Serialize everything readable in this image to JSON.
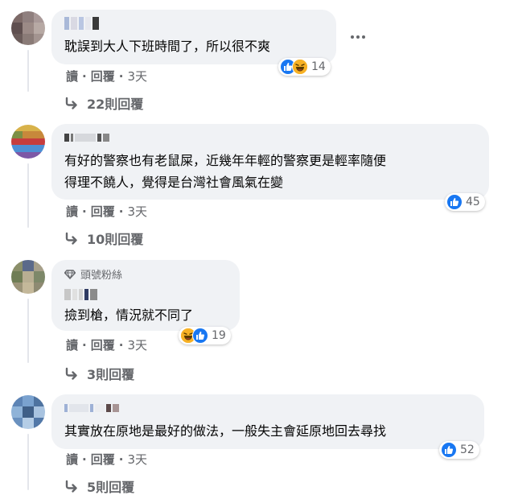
{
  "colors": {
    "bubble_bg": "#f0f2f5",
    "secondary_text": "#65676b",
    "like_blue": "#1877f2",
    "haha_yellow": "#f7b125"
  },
  "comments": [
    {
      "author_name_redacted": true,
      "text_lines": [
        "耽誤到大人下班時間了，所以很不爽"
      ],
      "actions": {
        "read": "讀",
        "reply": "回覆",
        "time": "3天"
      },
      "reactions": {
        "icons": [
          "like-icon",
          "haha-icon"
        ],
        "count": "14"
      },
      "replies_label": "22則回覆",
      "has_more_menu": true
    },
    {
      "author_name_redacted": true,
      "text_lines": [
        "有好的警察也有老鼠屎，近幾年年輕的警察更是輕率隨便",
        "得理不饒人，覺得是台灣社會風氣在變"
      ],
      "actions": {
        "read": "讀",
        "reply": "回覆",
        "time": "3天"
      },
      "reactions": {
        "icons": [
          "like-icon"
        ],
        "count": "45"
      },
      "replies_label": "10則回覆"
    },
    {
      "author_name_redacted": true,
      "badge": "頭號粉絲",
      "text_lines": [
        "撿到槍，情況就不同了"
      ],
      "actions": {
        "read": "讀",
        "reply": "回覆",
        "time": "3天"
      },
      "reactions": {
        "icons": [
          "haha-icon",
          "like-icon"
        ],
        "count": "19"
      },
      "replies_label": "3則回覆"
    },
    {
      "author_name_redacted": true,
      "text_lines": [
        "其實放在原地是最好的做法，一般失主會延原地回去尋找"
      ],
      "actions": {
        "read": "讀",
        "reply": "回覆",
        "time": "3天"
      },
      "reactions": {
        "icons": [
          "like-icon"
        ],
        "count": "52"
      },
      "replies_label": "5則回覆"
    }
  ]
}
